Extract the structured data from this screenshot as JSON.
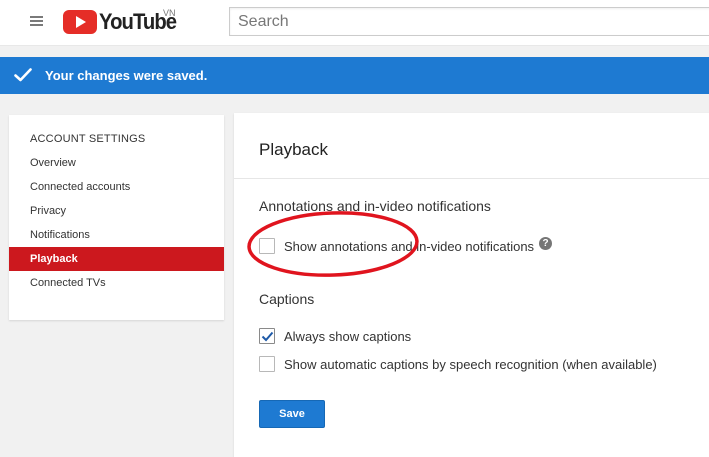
{
  "header": {
    "logo_text": "YouTube",
    "region": "VN",
    "search_placeholder": "Search"
  },
  "banner": {
    "message": "Your changes were saved.",
    "color": "#1e7ad2"
  },
  "sidebar": {
    "heading": "ACCOUNT SETTINGS",
    "items": [
      {
        "label": "Overview",
        "active": false
      },
      {
        "label": "Connected accounts",
        "active": false
      },
      {
        "label": "Privacy",
        "active": false
      },
      {
        "label": "Notifications",
        "active": false
      },
      {
        "label": "Playback",
        "active": true
      },
      {
        "label": "Connected TVs",
        "active": false
      }
    ],
    "active_color": "#cc181e"
  },
  "main": {
    "title": "Playback",
    "annotations_section": {
      "title": "Annotations and in-video notifications",
      "option": {
        "label": "Show annotations and in-video notifications",
        "checked": false,
        "help": "?"
      }
    },
    "captions_section": {
      "title": "Captions",
      "options": [
        {
          "label": "Always show captions",
          "checked": true
        },
        {
          "label": "Show automatic captions by speech recognition (when available)",
          "checked": false
        }
      ]
    },
    "save_label": "Save"
  },
  "icons": {
    "menu": "hamburger-menu-icon",
    "check": "checkmark-icon",
    "help": "question-circle-icon"
  },
  "annotation_color": "#e0141e"
}
